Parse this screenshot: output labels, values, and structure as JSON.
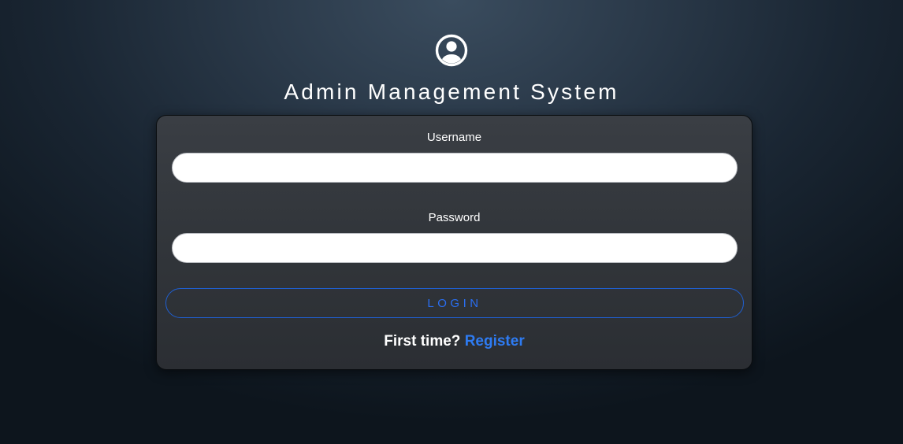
{
  "header": {
    "icon": "user-circle-icon",
    "title": "Admin Management System"
  },
  "form": {
    "username_label": "Username",
    "username_value": "",
    "username_placeholder": "",
    "password_label": "Password",
    "password_value": "",
    "password_placeholder": "",
    "login_label": "LOGIN",
    "register_prompt": "First time?",
    "register_link": "Register"
  },
  "colors": {
    "accent": "#2a6ef0",
    "link": "#2e7bf2",
    "card_bg": "#32363b",
    "page_bg": "#1a2633"
  }
}
